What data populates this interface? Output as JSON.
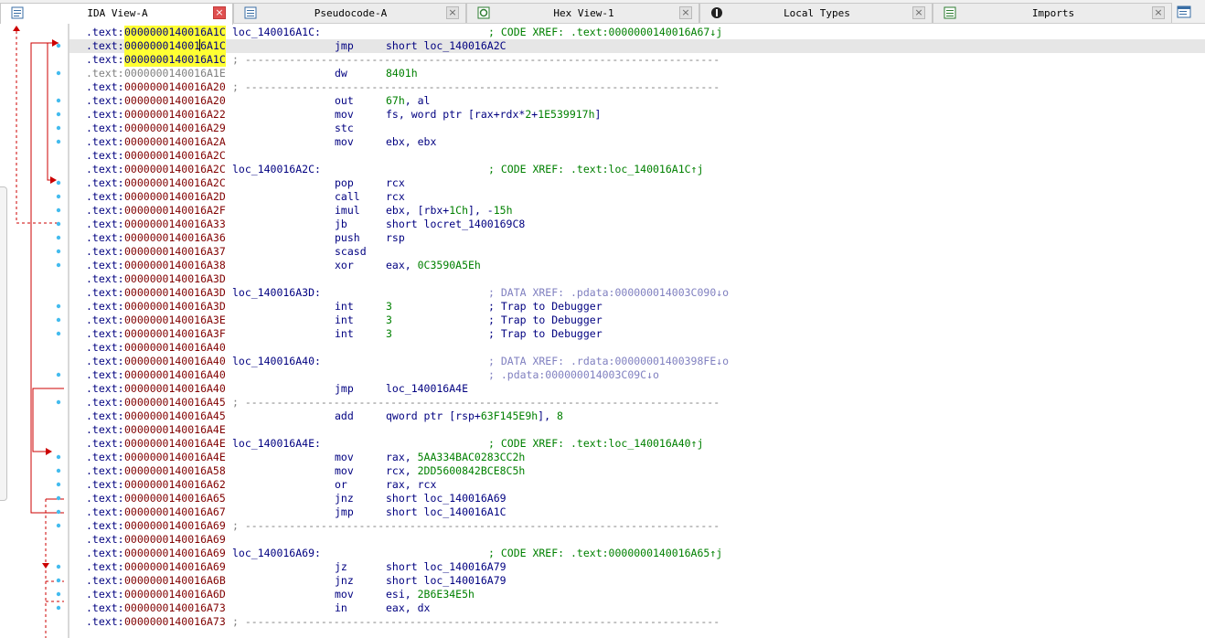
{
  "tabs": [
    {
      "label": "IDA View-A",
      "icon": "listing-icon",
      "active": true
    },
    {
      "label": "Pseudocode-A",
      "icon": "pseudocode-icon",
      "active": false
    },
    {
      "label": "Hex View-1",
      "icon": "hex-icon",
      "active": false
    },
    {
      "label": "Local Types",
      "icon": "types-icon",
      "active": false
    },
    {
      "label": "Imports",
      "icon": "imports-icon",
      "active": false
    }
  ],
  "tab_close_glyph": "×",
  "colors": {
    "address": "#800000",
    "text": "#000080",
    "comment": "#008000",
    "xref_data": "#8080c0",
    "highlight": "#ffff33",
    "arrow": "#cc0000",
    "dot": "#44bbee"
  },
  "lines": [
    {
      "seg": ".text:",
      "addr": "0000000140016A1C",
      "label": "loc_140016A1C:",
      "comment": "; CODE XREF: .text:0000000140016A67↓j",
      "highlight": true
    },
    {
      "seg": ".text:",
      "addr": "0000000140016A1C",
      "mnemonic": "jmp",
      "operands": "short loc_140016A2C",
      "highlight": true,
      "current": true
    },
    {
      "seg": ".text:",
      "addr": "0000000140016A1C",
      "sep": "; ---------------------------------------------------------------------------",
      "highlight": true
    },
    {
      "seg": ".text:",
      "addr": "0000000140016A1E",
      "mnemonic": "dw",
      "operands": "8401h",
      "gray": true
    },
    {
      "seg": ".text:",
      "addr": "0000000140016A20",
      "sep": "; ---------------------------------------------------------------------------"
    },
    {
      "seg": ".text:",
      "addr": "0000000140016A20",
      "mnemonic": "out",
      "operands": "67h, al"
    },
    {
      "seg": ".text:",
      "addr": "0000000140016A22",
      "mnemonic": "mov",
      "operands": "fs, word ptr [rax+rdx*2+1E539917h]"
    },
    {
      "seg": ".text:",
      "addr": "0000000140016A29",
      "mnemonic": "stc"
    },
    {
      "seg": ".text:",
      "addr": "0000000140016A2A",
      "mnemonic": "mov",
      "operands": "ebx, ebx"
    },
    {
      "seg": ".text:",
      "addr": "0000000140016A2C"
    },
    {
      "seg": ".text:",
      "addr": "0000000140016A2C",
      "label": "loc_140016A2C:",
      "comment": "; CODE XREF: .text:loc_140016A1C↑j"
    },
    {
      "seg": ".text:",
      "addr": "0000000140016A2C",
      "mnemonic": "pop",
      "operands": "rcx"
    },
    {
      "seg": ".text:",
      "addr": "0000000140016A2D",
      "mnemonic": "call",
      "operands": "rcx"
    },
    {
      "seg": ".text:",
      "addr": "0000000140016A2F",
      "mnemonic": "imul",
      "operands": "ebx, [rbx+1Ch], -15h"
    },
    {
      "seg": ".text:",
      "addr": "0000000140016A33",
      "mnemonic": "jb",
      "operands": "short locret_1400169C8"
    },
    {
      "seg": ".text:",
      "addr": "0000000140016A36",
      "mnemonic": "push",
      "operands": "rsp"
    },
    {
      "seg": ".text:",
      "addr": "0000000140016A37",
      "mnemonic": "scasd"
    },
    {
      "seg": ".text:",
      "addr": "0000000140016A38",
      "mnemonic": "xor",
      "operands": "eax, 0C3590A5Eh"
    },
    {
      "seg": ".text:",
      "addr": "0000000140016A3D"
    },
    {
      "seg": ".text:",
      "addr": "0000000140016A3D",
      "label": "loc_140016A3D:",
      "comment": "; DATA XREF: .pdata:000000014003C090↓o",
      "comment_kind": "data"
    },
    {
      "seg": ".text:",
      "addr": "0000000140016A3D",
      "mnemonic": "int",
      "operands": "3",
      "comment": "; Trap to Debugger",
      "comment_kind": "trap"
    },
    {
      "seg": ".text:",
      "addr": "0000000140016A3E",
      "mnemonic": "int",
      "operands": "3",
      "comment": "; Trap to Debugger",
      "comment_kind": "trap"
    },
    {
      "seg": ".text:",
      "addr": "0000000140016A3F",
      "mnemonic": "int",
      "operands": "3",
      "comment": "; Trap to Debugger",
      "comment_kind": "trap"
    },
    {
      "seg": ".text:",
      "addr": "0000000140016A40"
    },
    {
      "seg": ".text:",
      "addr": "0000000140016A40",
      "label": "loc_140016A40:",
      "comment": "; DATA XREF: .rdata:00000001400398FE↓o",
      "comment_kind": "data"
    },
    {
      "seg": ".text:",
      "addr": "0000000140016A40",
      "comment": "; .pdata:000000014003C09C↓o",
      "comment_kind": "data"
    },
    {
      "seg": ".text:",
      "addr": "0000000140016A40",
      "mnemonic": "jmp",
      "operands": "loc_140016A4E"
    },
    {
      "seg": ".text:",
      "addr": "0000000140016A45",
      "sep": "; ---------------------------------------------------------------------------"
    },
    {
      "seg": ".text:",
      "addr": "0000000140016A45",
      "mnemonic": "add",
      "operands": "qword ptr [rsp+63F145E9h], 8"
    },
    {
      "seg": ".text:",
      "addr": "0000000140016A4E"
    },
    {
      "seg": ".text:",
      "addr": "0000000140016A4E",
      "label": "loc_140016A4E:",
      "comment": "; CODE XREF: .text:loc_140016A40↑j"
    },
    {
      "seg": ".text:",
      "addr": "0000000140016A4E",
      "mnemonic": "mov",
      "operands": "rax, 5AA334BAC0283CC2h"
    },
    {
      "seg": ".text:",
      "addr": "0000000140016A58",
      "mnemonic": "mov",
      "operands": "rcx, 2DD5600842BCE8C5h"
    },
    {
      "seg": ".text:",
      "addr": "0000000140016A62",
      "mnemonic": "or",
      "operands": "rax, rcx"
    },
    {
      "seg": ".text:",
      "addr": "0000000140016A65",
      "mnemonic": "jnz",
      "operands": "short loc_140016A69"
    },
    {
      "seg": ".text:",
      "addr": "0000000140016A67",
      "mnemonic": "jmp",
      "operands": "short loc_140016A1C"
    },
    {
      "seg": ".text:",
      "addr": "0000000140016A69",
      "sep": "; ---------------------------------------------------------------------------"
    },
    {
      "seg": ".text:",
      "addr": "0000000140016A69"
    },
    {
      "seg": ".text:",
      "addr": "0000000140016A69",
      "label": "loc_140016A69:",
      "comment": "; CODE XREF: .text:0000000140016A65↑j"
    },
    {
      "seg": ".text:",
      "addr": "0000000140016A69",
      "mnemonic": "jz",
      "operands": "short loc_140016A79"
    },
    {
      "seg": ".text:",
      "addr": "0000000140016A6B",
      "mnemonic": "jnz",
      "operands": "short loc_140016A79"
    },
    {
      "seg": ".text:",
      "addr": "0000000140016A6D",
      "mnemonic": "mov",
      "operands": "esi, 2B6E34E5h"
    },
    {
      "seg": ".text:",
      "addr": "0000000140016A73",
      "mnemonic": "in",
      "operands": "eax, dx"
    },
    {
      "seg": ".text:",
      "addr": "0000000140016A73",
      "sep": "; ---------------------------------------------------------------------------"
    }
  ]
}
